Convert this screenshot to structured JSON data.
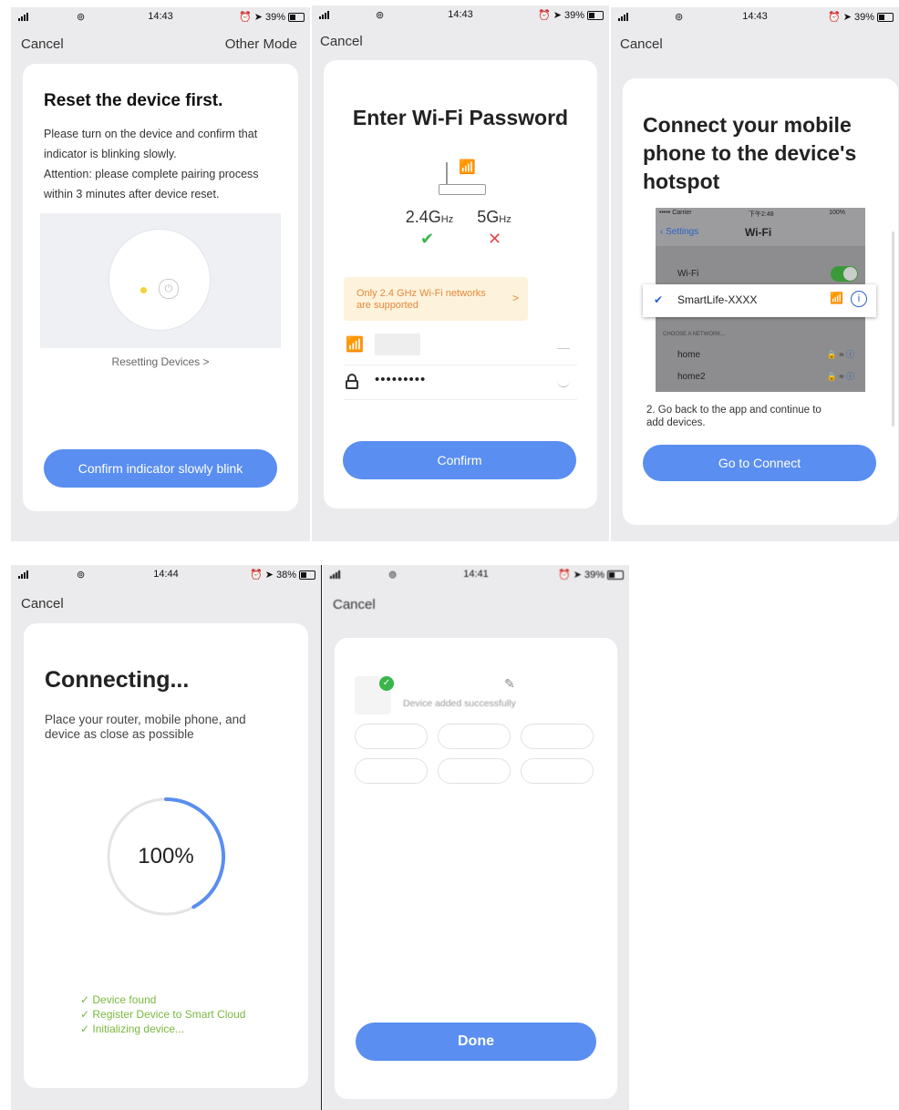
{
  "screens": [
    {
      "status": {
        "time": "14:43",
        "battery": "39%"
      },
      "nav": {
        "cancel": "Cancel",
        "other": "Other Mode"
      },
      "title": "Reset the device first.",
      "lines": [
        "Please turn on the device and confirm that",
        "indicator is blinking slowly.",
        "Attention: please complete pairing process",
        "within 3 minutes after device reset."
      ],
      "link": "Resetting Devices >",
      "button": "Confirm indicator slowly blink"
    },
    {
      "status": {
        "time": "14:43",
        "battery": "39%"
      },
      "nav": {
        "cancel": "Cancel"
      },
      "title": "Enter Wi-Fi Password",
      "band_24": "2.4G",
      "band_5": "5G",
      "band_unit": "Hz",
      "notice": [
        "Only 2.4 GHz Wi-Fi networks",
        "are supported"
      ],
      "notice_arrow": ">",
      "password": "•••••••••",
      "button": "Confirm"
    },
    {
      "status": {
        "time": "14:43",
        "battery": "39%"
      },
      "nav": {
        "cancel": "Cancel"
      },
      "title": [
        "Connect your mobile",
        "phone to the device's",
        "hotspot"
      ],
      "ios": {
        "carrier": "••••• Carrier",
        "time": "下午2:48",
        "battery": "100%",
        "back": "Settings",
        "title": "Wi-Fi",
        "wifi_label": "Wi-Fi",
        "network_selected": "SmartLife-XXXX",
        "section": "CHOOSE A NETWORK...",
        "networks": [
          "home",
          "home2"
        ]
      },
      "step": [
        "2. Go back to the app and continue to",
        "add devices."
      ],
      "button": "Go to Connect"
    },
    {
      "status": {
        "time": "14:44",
        "battery": "38%"
      },
      "nav": {
        "cancel": "Cancel"
      },
      "title": "Connecting...",
      "subtitle": [
        "Place your router, mobile phone, and",
        "device as close as possible"
      ],
      "progress_text": "100%",
      "progress": 1.0,
      "steps": [
        "Device found",
        "Register Device to Smart Cloud",
        "Initializing device..."
      ]
    },
    {
      "status": {
        "time": "14:41",
        "battery": "39%"
      },
      "nav": {
        "cancel": "Cancel"
      },
      "message": "Device added successfully",
      "button": "Done"
    }
  ],
  "colors": {
    "accent": "#5a8ef0",
    "success": "#3ab54a",
    "error": "#e64a4a",
    "notice_bg": "#fdf3dc",
    "notice_text": "#e8873a",
    "steps": "#7ab840"
  }
}
